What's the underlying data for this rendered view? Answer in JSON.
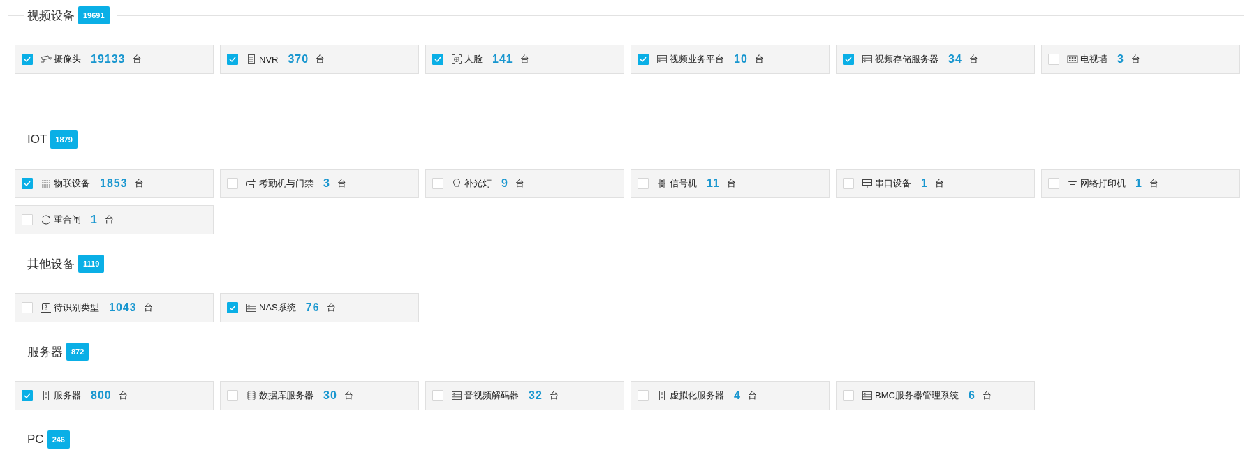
{
  "sections": [
    {
      "title": "视频设备",
      "count": "19691",
      "devices": [
        {
          "kind": "camera",
          "name": "摄像头",
          "count": "19133",
          "unit": "台",
          "checked": true
        },
        {
          "kind": "nvr",
          "name": "NVR",
          "count": "370",
          "unit": "台",
          "checked": true
        },
        {
          "kind": "face",
          "name": "人脸",
          "count": "141",
          "unit": "台",
          "checked": true
        },
        {
          "kind": "rack",
          "name": "视频业务平台",
          "count": "10",
          "unit": "台",
          "checked": true
        },
        {
          "kind": "rack",
          "name": "视频存储服务器",
          "count": "34",
          "unit": "台",
          "checked": true
        },
        {
          "kind": "grid",
          "name": "电视墙",
          "count": "3",
          "unit": "台",
          "checked": false
        }
      ]
    },
    {
      "title": "IOT",
      "count": "1879",
      "devices": [
        {
          "kind": "iot",
          "name": "物联设备",
          "count": "1853",
          "unit": "台",
          "checked": true
        },
        {
          "kind": "printer",
          "name": "考勤机与门禁",
          "count": "3",
          "unit": "台",
          "checked": false
        },
        {
          "kind": "bulb",
          "name": "补光灯",
          "count": "9",
          "unit": "台",
          "checked": false
        },
        {
          "kind": "signal",
          "name": "信号机",
          "count": "11",
          "unit": "台",
          "checked": false
        },
        {
          "kind": "serial",
          "name": "串口设备",
          "count": "1",
          "unit": "台",
          "checked": false
        },
        {
          "kind": "printer",
          "name": "网络打印机",
          "count": "1",
          "unit": "台",
          "checked": false
        },
        {
          "kind": "reload",
          "name": "重合闸",
          "count": "1",
          "unit": "台",
          "checked": false
        }
      ]
    },
    {
      "title": "其他设备",
      "count": "1119",
      "devices": [
        {
          "kind": "unknown",
          "name": "待识别类型",
          "count": "1043",
          "unit": "台",
          "checked": false
        },
        {
          "kind": "rack",
          "name": "NAS系统",
          "count": "76",
          "unit": "台",
          "checked": true
        }
      ]
    },
    {
      "title": "服务器",
      "count": "872",
      "devices": [
        {
          "kind": "tower",
          "name": "服务器",
          "count": "800",
          "unit": "台",
          "checked": true
        },
        {
          "kind": "database",
          "name": "数据库服务器",
          "count": "30",
          "unit": "台",
          "checked": false
        },
        {
          "kind": "rack",
          "name": "音视频解码器",
          "count": "32",
          "unit": "台",
          "checked": false
        },
        {
          "kind": "tower",
          "name": "虚拟化服务器",
          "count": "4",
          "unit": "台",
          "checked": false
        },
        {
          "kind": "rack",
          "name": "BMC服务器管理系统",
          "count": "6",
          "unit": "台",
          "checked": false
        }
      ]
    },
    {
      "title": "PC",
      "count": "246"
    }
  ]
}
